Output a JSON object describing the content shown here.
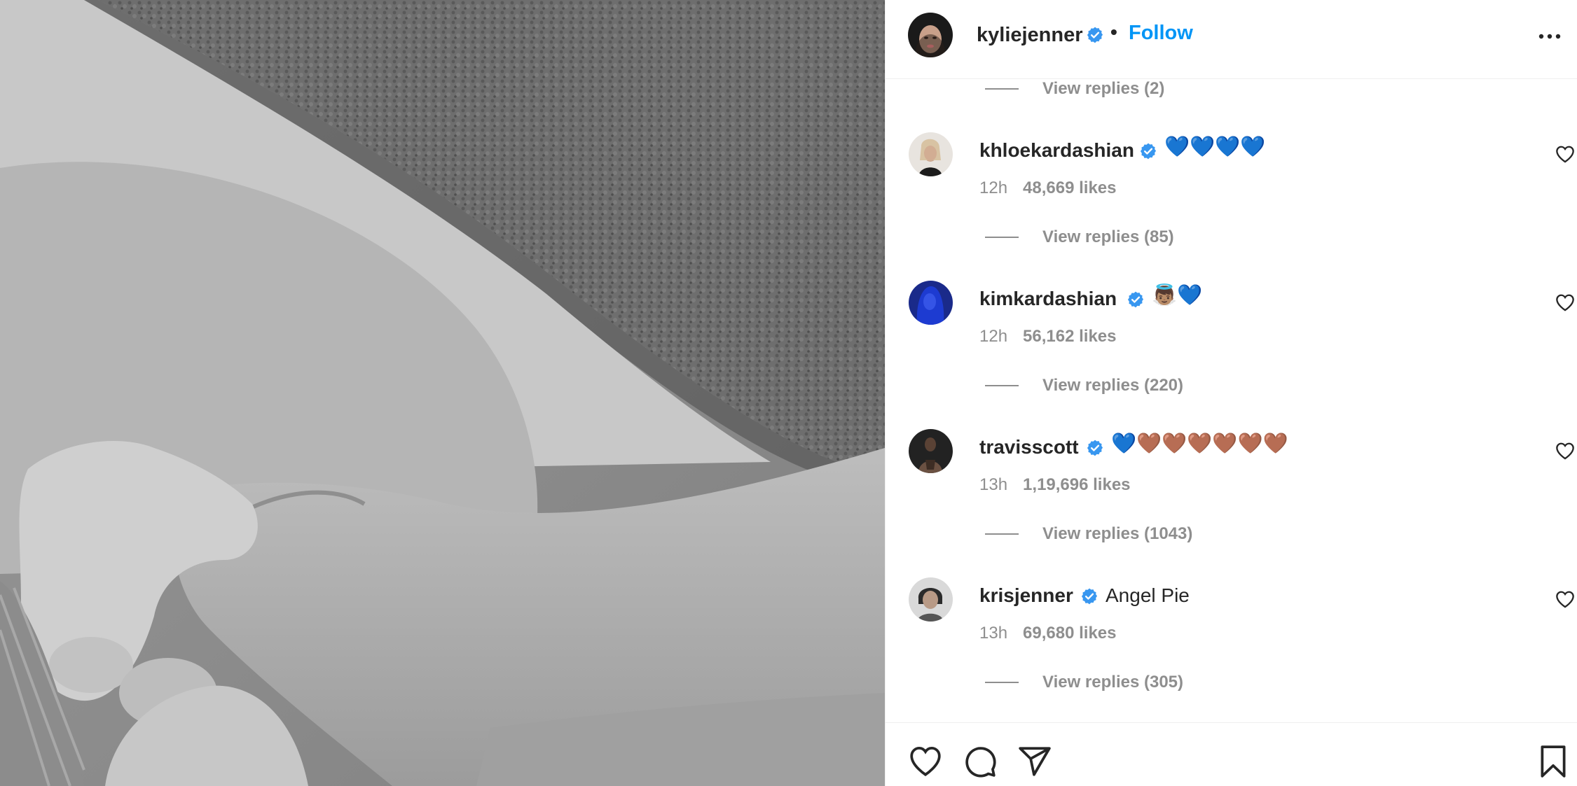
{
  "post": {
    "author": "kyliejenner",
    "separator": "•",
    "follow_label": "Follow"
  },
  "top_replies": {
    "label": "View replies (2)"
  },
  "comments": [
    {
      "user": "khloekardashian",
      "text": "💙💙💙💙",
      "time": "12h",
      "likes": "48,669 likes",
      "replies": "View replies (85)"
    },
    {
      "user": "kimkardashian",
      "text": "👼🏽💙",
      "time": "12h",
      "likes": "56,162 likes",
      "replies": "View replies (220)"
    },
    {
      "user": "travisscott",
      "text": "💙🤎🤎🤎🤎🤎🤎",
      "time": "13h",
      "likes": "1,19,696 likes",
      "replies": "View replies (1043)"
    },
    {
      "user": "krisjenner",
      "text": "Angel Pie",
      "time": "13h",
      "likes": "69,680 likes",
      "replies": "View replies (305)"
    }
  ],
  "colors": {
    "accent": "#0095f6",
    "verified": "#3897f0",
    "muted": "#8e8e8e",
    "text": "#262626"
  },
  "icons": [
    "verified-badge-icon",
    "more-options-icon",
    "heart-icon",
    "comment-icon",
    "share-icon",
    "bookmark-icon"
  ]
}
